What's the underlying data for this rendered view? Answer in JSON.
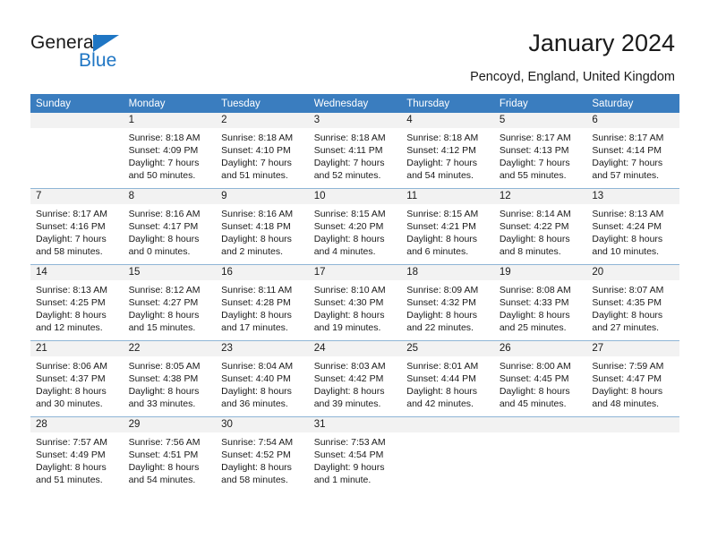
{
  "brand": {
    "name_part1": "General",
    "name_part2": "Blue"
  },
  "header": {
    "title": "January 2024",
    "subtitle": "Pencoyd, England, United Kingdom"
  },
  "colors": {
    "header_blue": "#3a7dbf",
    "brand_blue": "#1f76c4",
    "daynum_bg": "#f2f2f2",
    "grid_line": "#8fb5d6"
  },
  "weekdays": [
    "Sunday",
    "Monday",
    "Tuesday",
    "Wednesday",
    "Thursday",
    "Friday",
    "Saturday"
  ],
  "weeks": [
    [
      {
        "day": "",
        "sunrise": "",
        "sunset": "",
        "daylight_line1": "",
        "daylight_line2": ""
      },
      {
        "day": "1",
        "sunrise": "Sunrise: 8:18 AM",
        "sunset": "Sunset: 4:09 PM",
        "daylight_line1": "Daylight: 7 hours",
        "daylight_line2": "and 50 minutes."
      },
      {
        "day": "2",
        "sunrise": "Sunrise: 8:18 AM",
        "sunset": "Sunset: 4:10 PM",
        "daylight_line1": "Daylight: 7 hours",
        "daylight_line2": "and 51 minutes."
      },
      {
        "day": "3",
        "sunrise": "Sunrise: 8:18 AM",
        "sunset": "Sunset: 4:11 PM",
        "daylight_line1": "Daylight: 7 hours",
        "daylight_line2": "and 52 minutes."
      },
      {
        "day": "4",
        "sunrise": "Sunrise: 8:18 AM",
        "sunset": "Sunset: 4:12 PM",
        "daylight_line1": "Daylight: 7 hours",
        "daylight_line2": "and 54 minutes."
      },
      {
        "day": "5",
        "sunrise": "Sunrise: 8:17 AM",
        "sunset": "Sunset: 4:13 PM",
        "daylight_line1": "Daylight: 7 hours",
        "daylight_line2": "and 55 minutes."
      },
      {
        "day": "6",
        "sunrise": "Sunrise: 8:17 AM",
        "sunset": "Sunset: 4:14 PM",
        "daylight_line1": "Daylight: 7 hours",
        "daylight_line2": "and 57 minutes."
      }
    ],
    [
      {
        "day": "7",
        "sunrise": "Sunrise: 8:17 AM",
        "sunset": "Sunset: 4:16 PM",
        "daylight_line1": "Daylight: 7 hours",
        "daylight_line2": "and 58 minutes."
      },
      {
        "day": "8",
        "sunrise": "Sunrise: 8:16 AM",
        "sunset": "Sunset: 4:17 PM",
        "daylight_line1": "Daylight: 8 hours",
        "daylight_line2": "and 0 minutes."
      },
      {
        "day": "9",
        "sunrise": "Sunrise: 8:16 AM",
        "sunset": "Sunset: 4:18 PM",
        "daylight_line1": "Daylight: 8 hours",
        "daylight_line2": "and 2 minutes."
      },
      {
        "day": "10",
        "sunrise": "Sunrise: 8:15 AM",
        "sunset": "Sunset: 4:20 PM",
        "daylight_line1": "Daylight: 8 hours",
        "daylight_line2": "and 4 minutes."
      },
      {
        "day": "11",
        "sunrise": "Sunrise: 8:15 AM",
        "sunset": "Sunset: 4:21 PM",
        "daylight_line1": "Daylight: 8 hours",
        "daylight_line2": "and 6 minutes."
      },
      {
        "day": "12",
        "sunrise": "Sunrise: 8:14 AM",
        "sunset": "Sunset: 4:22 PM",
        "daylight_line1": "Daylight: 8 hours",
        "daylight_line2": "and 8 minutes."
      },
      {
        "day": "13",
        "sunrise": "Sunrise: 8:13 AM",
        "sunset": "Sunset: 4:24 PM",
        "daylight_line1": "Daylight: 8 hours",
        "daylight_line2": "and 10 minutes."
      }
    ],
    [
      {
        "day": "14",
        "sunrise": "Sunrise: 8:13 AM",
        "sunset": "Sunset: 4:25 PM",
        "daylight_line1": "Daylight: 8 hours",
        "daylight_line2": "and 12 minutes."
      },
      {
        "day": "15",
        "sunrise": "Sunrise: 8:12 AM",
        "sunset": "Sunset: 4:27 PM",
        "daylight_line1": "Daylight: 8 hours",
        "daylight_line2": "and 15 minutes."
      },
      {
        "day": "16",
        "sunrise": "Sunrise: 8:11 AM",
        "sunset": "Sunset: 4:28 PM",
        "daylight_line1": "Daylight: 8 hours",
        "daylight_line2": "and 17 minutes."
      },
      {
        "day": "17",
        "sunrise": "Sunrise: 8:10 AM",
        "sunset": "Sunset: 4:30 PM",
        "daylight_line1": "Daylight: 8 hours",
        "daylight_line2": "and 19 minutes."
      },
      {
        "day": "18",
        "sunrise": "Sunrise: 8:09 AM",
        "sunset": "Sunset: 4:32 PM",
        "daylight_line1": "Daylight: 8 hours",
        "daylight_line2": "and 22 minutes."
      },
      {
        "day": "19",
        "sunrise": "Sunrise: 8:08 AM",
        "sunset": "Sunset: 4:33 PM",
        "daylight_line1": "Daylight: 8 hours",
        "daylight_line2": "and 25 minutes."
      },
      {
        "day": "20",
        "sunrise": "Sunrise: 8:07 AM",
        "sunset": "Sunset: 4:35 PM",
        "daylight_line1": "Daylight: 8 hours",
        "daylight_line2": "and 27 minutes."
      }
    ],
    [
      {
        "day": "21",
        "sunrise": "Sunrise: 8:06 AM",
        "sunset": "Sunset: 4:37 PM",
        "daylight_line1": "Daylight: 8 hours",
        "daylight_line2": "and 30 minutes."
      },
      {
        "day": "22",
        "sunrise": "Sunrise: 8:05 AM",
        "sunset": "Sunset: 4:38 PM",
        "daylight_line1": "Daylight: 8 hours",
        "daylight_line2": "and 33 minutes."
      },
      {
        "day": "23",
        "sunrise": "Sunrise: 8:04 AM",
        "sunset": "Sunset: 4:40 PM",
        "daylight_line1": "Daylight: 8 hours",
        "daylight_line2": "and 36 minutes."
      },
      {
        "day": "24",
        "sunrise": "Sunrise: 8:03 AM",
        "sunset": "Sunset: 4:42 PM",
        "daylight_line1": "Daylight: 8 hours",
        "daylight_line2": "and 39 minutes."
      },
      {
        "day": "25",
        "sunrise": "Sunrise: 8:01 AM",
        "sunset": "Sunset: 4:44 PM",
        "daylight_line1": "Daylight: 8 hours",
        "daylight_line2": "and 42 minutes."
      },
      {
        "day": "26",
        "sunrise": "Sunrise: 8:00 AM",
        "sunset": "Sunset: 4:45 PM",
        "daylight_line1": "Daylight: 8 hours",
        "daylight_line2": "and 45 minutes."
      },
      {
        "day": "27",
        "sunrise": "Sunrise: 7:59 AM",
        "sunset": "Sunset: 4:47 PM",
        "daylight_line1": "Daylight: 8 hours",
        "daylight_line2": "and 48 minutes."
      }
    ],
    [
      {
        "day": "28",
        "sunrise": "Sunrise: 7:57 AM",
        "sunset": "Sunset: 4:49 PM",
        "daylight_line1": "Daylight: 8 hours",
        "daylight_line2": "and 51 minutes."
      },
      {
        "day": "29",
        "sunrise": "Sunrise: 7:56 AM",
        "sunset": "Sunset: 4:51 PM",
        "daylight_line1": "Daylight: 8 hours",
        "daylight_line2": "and 54 minutes."
      },
      {
        "day": "30",
        "sunrise": "Sunrise: 7:54 AM",
        "sunset": "Sunset: 4:52 PM",
        "daylight_line1": "Daylight: 8 hours",
        "daylight_line2": "and 58 minutes."
      },
      {
        "day": "31",
        "sunrise": "Sunrise: 7:53 AM",
        "sunset": "Sunset: 4:54 PM",
        "daylight_line1": "Daylight: 9 hours",
        "daylight_line2": "and 1 minute."
      },
      {
        "day": "",
        "sunrise": "",
        "sunset": "",
        "daylight_line1": "",
        "daylight_line2": ""
      },
      {
        "day": "",
        "sunrise": "",
        "sunset": "",
        "daylight_line1": "",
        "daylight_line2": ""
      },
      {
        "day": "",
        "sunrise": "",
        "sunset": "",
        "daylight_line1": "",
        "daylight_line2": ""
      }
    ]
  ]
}
